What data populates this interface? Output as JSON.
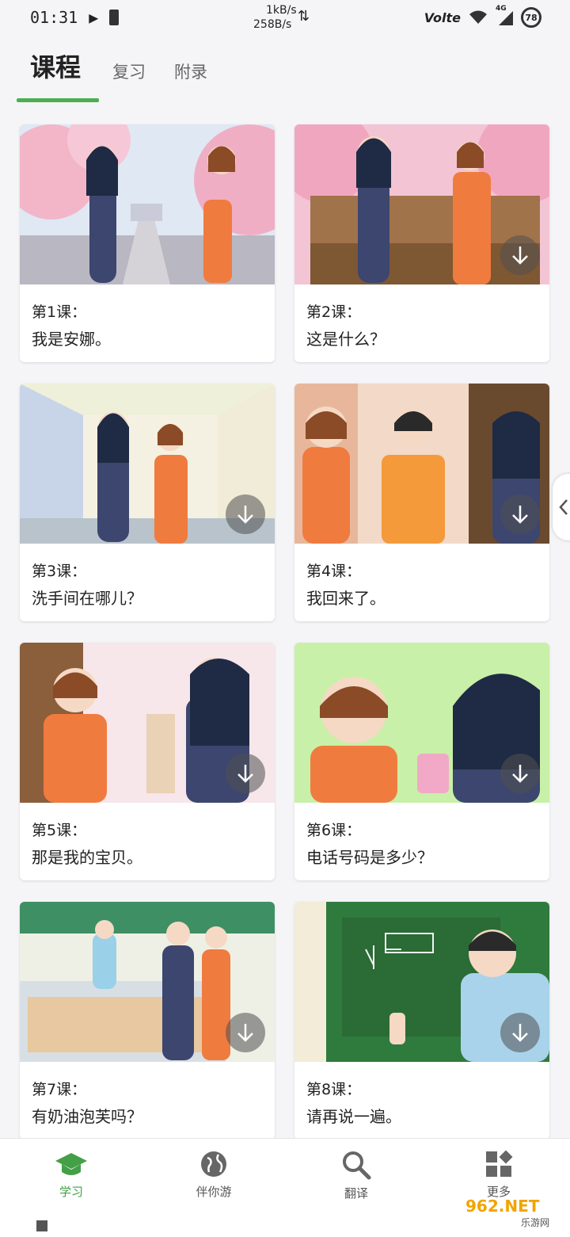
{
  "status_bar": {
    "time": "01:31",
    "speed_down": "1kB/s",
    "speed_up": "258B/s",
    "network": "Volte",
    "signal": "4G",
    "battery": "78"
  },
  "tabs": [
    {
      "label": "课程",
      "active": true
    },
    {
      "label": "复习",
      "active": false
    },
    {
      "label": "附录",
      "active": false
    }
  ],
  "lessons": [
    {
      "number": "第1课：",
      "title": "我是安娜。",
      "downloadable": false
    },
    {
      "number": "第2课：",
      "title": "这是什么？",
      "downloadable": true
    },
    {
      "number": "第3课：",
      "title": "洗手间在哪儿？",
      "downloadable": true
    },
    {
      "number": "第4课：",
      "title": "我回来了。",
      "downloadable": true
    },
    {
      "number": "第5课：",
      "title": "那是我的宝贝。",
      "downloadable": true
    },
    {
      "number": "第6课：",
      "title": "电话号码是多少？",
      "downloadable": true
    },
    {
      "number": "第7课：",
      "title": "有奶油泡芙吗？",
      "downloadable": true
    },
    {
      "number": "第8课：",
      "title": "请再说一遍。",
      "downloadable": true
    }
  ],
  "bottom_nav": [
    {
      "label": "学习",
      "icon": "graduation-cap-icon",
      "active": true
    },
    {
      "label": "伴你游",
      "icon": "globe-icon",
      "active": false
    },
    {
      "label": "翻译",
      "icon": "search-icon",
      "active": false
    },
    {
      "label": "更多",
      "icon": "apps-icon",
      "active": false
    }
  ],
  "watermark": {
    "brand": "962.NET",
    "sub": "乐游网"
  },
  "colors": {
    "accent": "#4caf50",
    "active_nav": "#43a047"
  }
}
